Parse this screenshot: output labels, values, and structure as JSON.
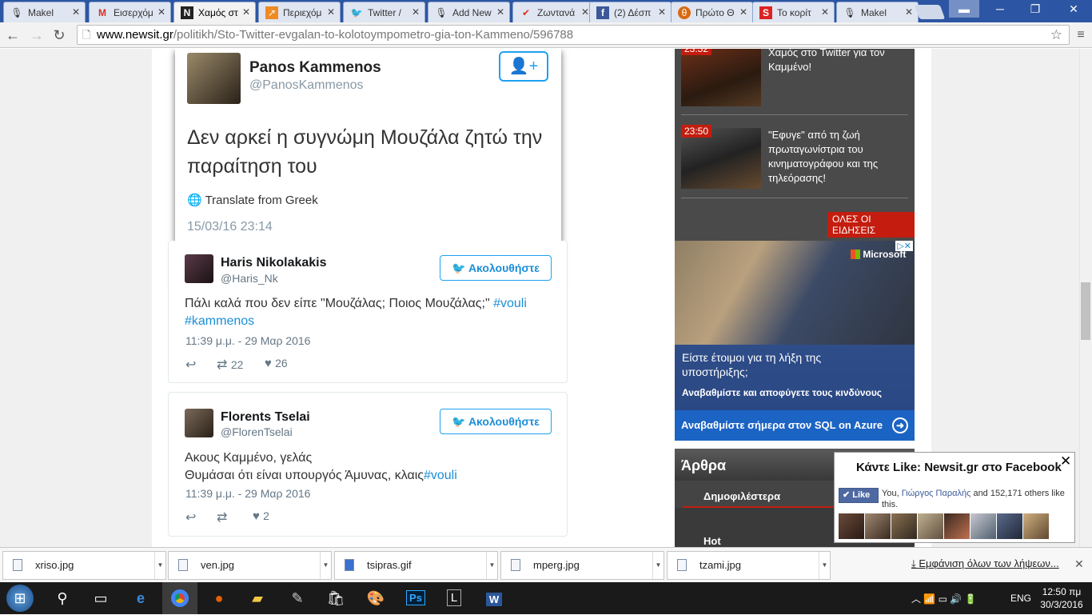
{
  "browser": {
    "tabs": [
      {
        "title": "Makel",
        "icon": "microphone-icon"
      },
      {
        "title": "Εισερχόμ",
        "icon": "gmail-icon"
      },
      {
        "title": "Χαμός στ",
        "icon": "newsit-icon"
      },
      {
        "title": "Περιεχόμ",
        "icon": "chart-icon"
      },
      {
        "title": "Twitter /",
        "icon": "twitter-icon"
      },
      {
        "title": "Add New",
        "icon": "microphone-icon"
      },
      {
        "title": "Ζωντανά",
        "icon": "check-icon"
      },
      {
        "title": "(2) Δέσπ",
        "icon": "facebook-icon"
      },
      {
        "title": "Πρώτο Θ",
        "icon": "protothema-icon"
      },
      {
        "title": "Το κορίτ",
        "icon": "s-icon"
      },
      {
        "title": "Makel",
        "icon": "microphone-icon"
      }
    ],
    "url_host": "www.newsit.gr",
    "url_path": "/politikh/Sto-Twitter-evgalan-to-kolotoympometro-gia-ton-Kammeno/596788",
    "window_controls": {
      "minimize": "─",
      "maximize": "❐",
      "close": "✕"
    }
  },
  "embedded_tweet": {
    "name": "Panos Kammenos",
    "handle": "@PanosKammenos",
    "text": "Δεν αρκεί η συγνώμη Μουζάλα ζητώ την παραίτηση του",
    "translate": "Translate from Greek",
    "date": "15/03/16 23:14"
  },
  "tweets": [
    {
      "name": "Haris Nikolakakis",
      "handle": "@Haris_Nk",
      "follow": "Ακολουθήστε",
      "text_plain": "Πάλι καλά που δεν είπε \"Μουζάλας; Ποιος Μουζάλας;\" ",
      "hashtag1": "#vouli",
      "hashtag2": "#kammenos",
      "date": "11:39 μ.μ. - 29 Μαρ 2016",
      "retweets": "22",
      "likes": "26"
    },
    {
      "name": "Florents Tselai",
      "handle": "@FlorenTselai",
      "follow": "Ακολουθήστε",
      "line1": "Ακους Καμμένο, γελάς",
      "line2_plain": "Θυμάσαι ότι είναι υπουργός Άμυνας, κλαις",
      "hashtag": "#vouli",
      "date": "11:39 μ.μ. - 29 Μαρ 2016",
      "likes": "2"
    }
  ],
  "news": {
    "items": [
      {
        "time": "23:52",
        "text": "Χαμός στο Twitter για τον Καμμένο!"
      },
      {
        "time": "23:50",
        "text": "\"Εφυγε\" από τη ζωή πρωταγωνίστρια του κινηματογράφου και της τηλεόρασης!"
      }
    ],
    "all_news": "ΟΛΕΣ ΟΙ ΕΙΔΗΣΕΙΣ"
  },
  "ad": {
    "brand": "Microsoft",
    "question": "Είστε έτοιμοι για τη λήξη της υποστήριξης;",
    "subline": "Αναβαθμίστε και αποφύγετε τους κινδύνους",
    "cta": "Αναβαθμίστε σήμερα στον SQL on Azure"
  },
  "articles": {
    "title": "Άρθρα",
    "tabs": [
      "Δημοφιλέστερα",
      "Hot"
    ]
  },
  "facebook_popup": {
    "title": "Κάντε Like: Newsit.gr στο Facebook",
    "like": "Like",
    "text_you": "You, ",
    "friend": "Γιώργος Παραλής",
    "text_rest": " and 152,171 others like this."
  },
  "downloads": {
    "files": [
      "xriso.jpg",
      "ven.jpg",
      "tsipras.gif",
      "mperg.jpg",
      "tzami.jpg"
    ],
    "show_all": "Εμφάνιση όλων των λήψεων...",
    "close": "✕"
  },
  "taskbar": {
    "lang": "ENG",
    "time": "12:50 πμ",
    "date": "30/3/2016"
  },
  "colors": {
    "twitter_blue": "#1da1f2",
    "news_red": "#c41c0e",
    "azure_blue": "#1c64c4"
  }
}
